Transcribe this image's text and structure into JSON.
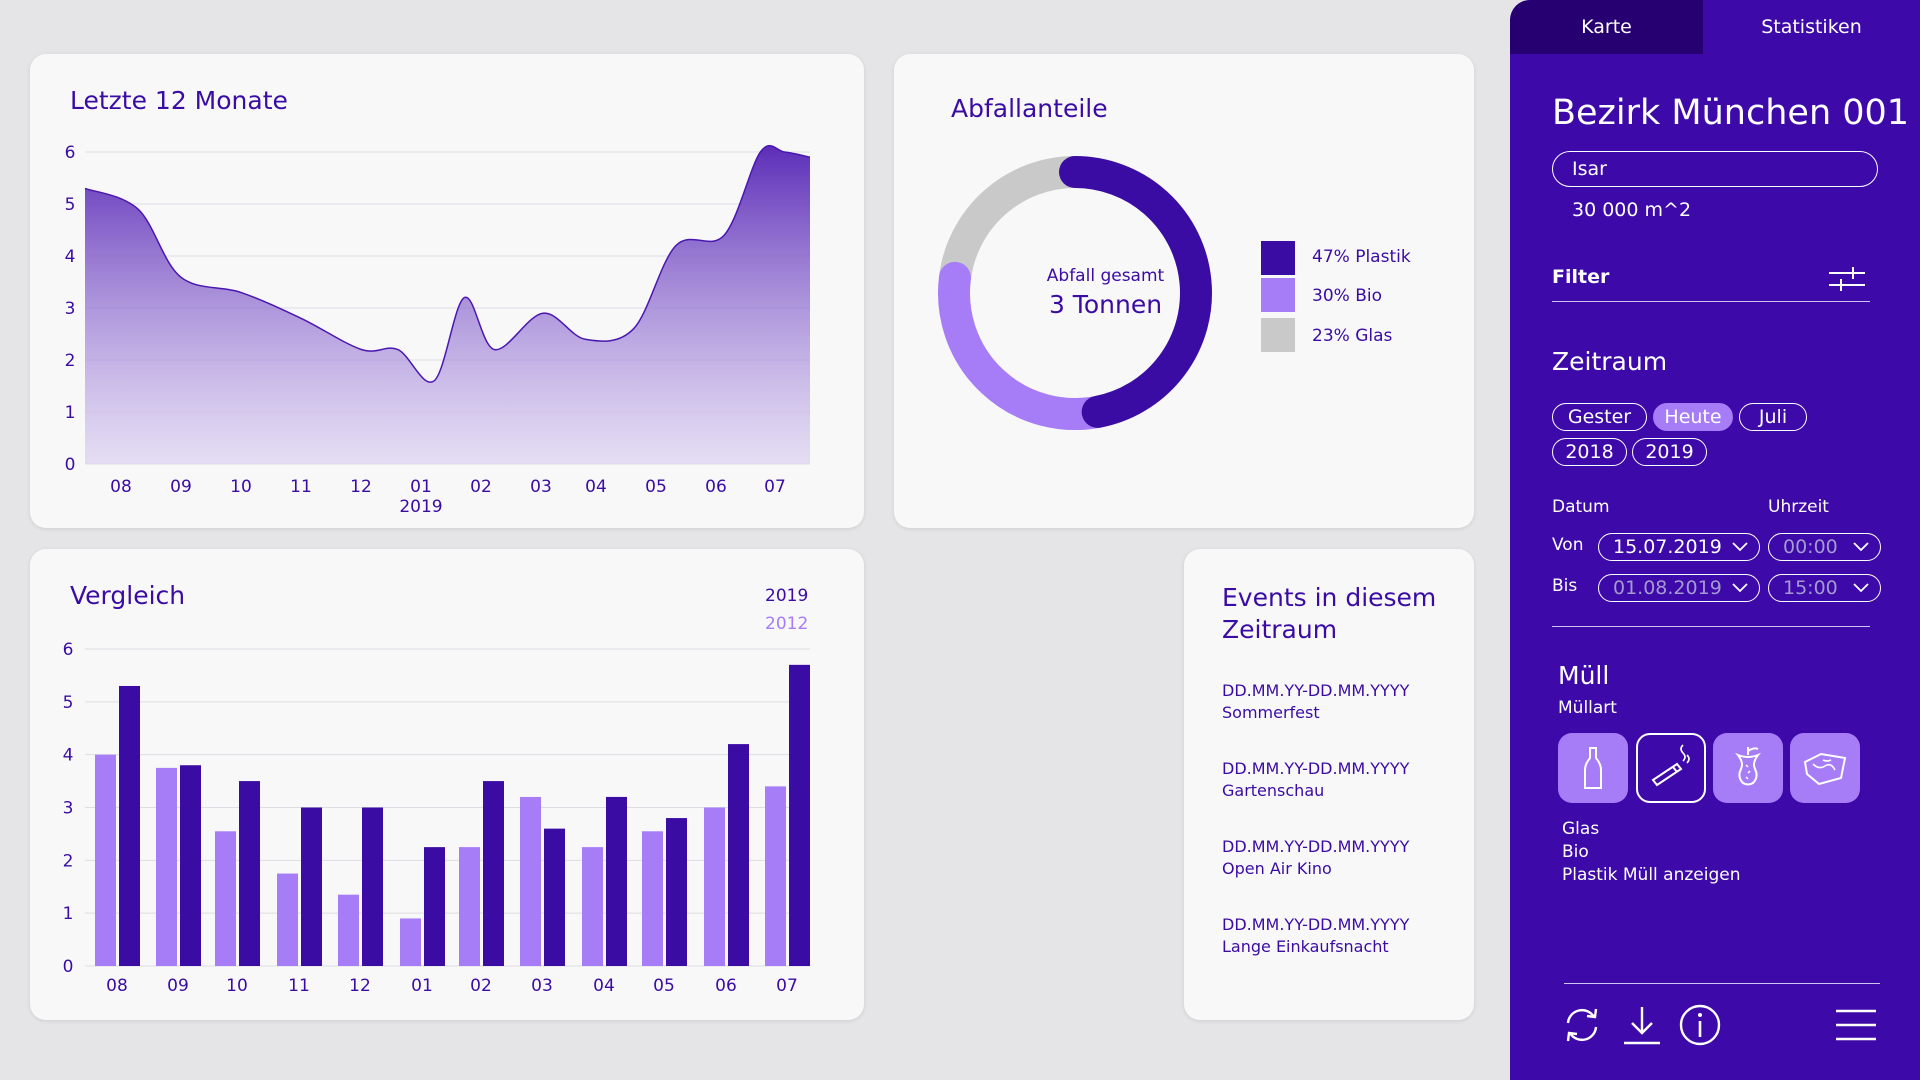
{
  "colors": {
    "primary": "#3a0ca3",
    "secondary": "#a77cf7",
    "gray": "#c9c9c9",
    "sidebar": "#3d09a8"
  },
  "area_chart": {
    "title": "Letzte 12 Monate",
    "year_label": "2019"
  },
  "donut": {
    "title": "Abfallanteile",
    "center_label": "Abfall gesamt",
    "center_value": "3 Tonnen",
    "legend": [
      {
        "label": "47% Plastik",
        "color": "#3a0ca3"
      },
      {
        "label": "30% Bio",
        "color": "#a77cf7"
      },
      {
        "label": "23% Glas",
        "color": "#c9c9c9"
      }
    ]
  },
  "bar_chart": {
    "title": "Vergleich",
    "legend_primary": "2019",
    "legend_secondary": "2012"
  },
  "events": {
    "title_line1": "Events in diesem",
    "title_line2": "Zeitraum",
    "items": [
      {
        "date": "DD.MM.YY-DD.MM.YYYY",
        "name": "Sommerfest"
      },
      {
        "date": "DD.MM.YY-DD.MM.YYYY",
        "name": "Gartenschau"
      },
      {
        "date": "DD.MM.YY-DD.MM.YYYY",
        "name": "Open Air Kino"
      },
      {
        "date": "DD.MM.YY-DD.MM.YYYY",
        "name": "Lange Einkaufsnacht"
      }
    ]
  },
  "sidebar": {
    "tabs": [
      "Karte",
      "Statistiken"
    ],
    "active_tab": "Statistiken",
    "district": "Bezirk München 001",
    "river": "Isar",
    "area": "30 000 m^2",
    "filter_label": "Filter",
    "zeitraum_title": "Zeitraum",
    "chips": [
      {
        "label": "Gester",
        "active": false
      },
      {
        "label": "Heute",
        "active": true
      },
      {
        "label": "Juli",
        "active": false
      },
      {
        "label": "2018",
        "active": false
      },
      {
        "label": "2019",
        "active": false
      }
    ],
    "datum_label": "Datum",
    "uhrzeit_label": "Uhrzeit",
    "von_label": "Von",
    "bis_label": "Bis",
    "von_date": "15.07.2019",
    "von_time": "00:00",
    "bis_date": "01.08.2019",
    "bis_time": "15:00",
    "muell_title": "Müll",
    "muellart_label": "Müllart",
    "waste_icons": [
      "bottle-icon",
      "cigarette-icon",
      "apple-core-icon",
      "plastic-bag-icon"
    ],
    "selected_waste": "cigarette-icon",
    "waste_list": [
      "Glas",
      "Bio",
      "Plastik Müll anzeigen"
    ],
    "bottom_icons": [
      "refresh-icon",
      "download-icon",
      "info-icon",
      "menu-icon"
    ]
  },
  "chart_data": [
    {
      "type": "area",
      "title": "Letzte 12 Monate",
      "categories": [
        "08",
        "09",
        "10",
        "11",
        "12",
        "01",
        "02",
        "03",
        "04",
        "05",
        "06",
        "07"
      ],
      "x_secondary_label": "2019",
      "x": [
        0,
        0.3,
        1,
        2,
        3,
        4,
        4.6,
        5.2,
        5.7,
        6.2,
        7,
        7.7,
        8.5,
        9.2,
        10,
        10.6,
        11,
        11.55
      ],
      "y": [
        5.3,
        4.9,
        3.6,
        3.3,
        2.8,
        2.2,
        2.2,
        1.6,
        3.2,
        2.2,
        2.9,
        2.4,
        2.6,
        4.2,
        4.4,
        6.0,
        6.0,
        5.9
      ],
      "ylim": [
        0,
        6
      ],
      "yticks": [
        0,
        1,
        2,
        3,
        4,
        5,
        6
      ],
      "grid": true
    },
    {
      "type": "pie",
      "title": "Abfallanteile",
      "labels": [
        "Plastik",
        "Bio",
        "Glas"
      ],
      "values": [
        47,
        30,
        23
      ]
    },
    {
      "type": "bar",
      "title": "Vergleich",
      "categories": [
        "08",
        "09",
        "10",
        "11",
        "12",
        "01",
        "02",
        "03",
        "04",
        "05",
        "06",
        "07"
      ],
      "series": [
        {
          "name": "2012",
          "values": [
            4.0,
            3.75,
            2.55,
            1.75,
            1.35,
            0.9,
            2.25,
            3.2,
            2.25,
            2.55,
            3.0,
            3.4
          ]
        },
        {
          "name": "2019",
          "values": [
            5.3,
            3.8,
            3.5,
            3.0,
            3.0,
            2.25,
            3.5,
            2.6,
            3.2,
            2.8,
            4.2,
            5.7
          ]
        }
      ],
      "ylim": [
        0,
        6
      ],
      "yticks": [
        0,
        1,
        2,
        3,
        4,
        5,
        6
      ],
      "grid": true
    }
  ]
}
